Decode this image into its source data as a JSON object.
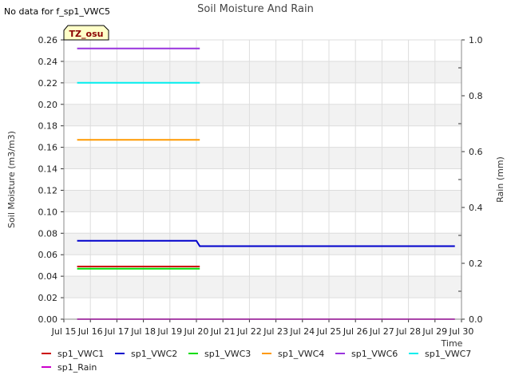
{
  "header": {
    "no_data_note": "No data for f_sp1_VWC5",
    "site_badge": "TZ_osu"
  },
  "colors": {
    "band": "#f2f2f2",
    "grid": "#dddddd",
    "badge_fill": "#ffffc8",
    "badge_text": "#8b0000"
  },
  "chart_data": {
    "type": "line",
    "title": "Soil Moisture And Rain",
    "xlabel": "Time",
    "ylabel": "Soil Moisture (m3/m3)",
    "y2label": "Rain (mm)",
    "x_range": [
      "Jul 15",
      "Jul 30"
    ],
    "x_ticks": [
      "Jul 15",
      "Jul 16",
      "Jul 17",
      "Jul 18",
      "Jul 19",
      "Jul 20",
      "Jul 21",
      "Jul 22",
      "Jul 23",
      "Jul 24",
      "Jul 25",
      "Jul 26",
      "Jul 27",
      "Jul 28",
      "Jul 29",
      "Jul 30"
    ],
    "ylim": [
      0,
      0.26
    ],
    "y_ticks": [
      "0.00",
      "0.02",
      "0.04",
      "0.06",
      "0.08",
      "0.10",
      "0.12",
      "0.14",
      "0.16",
      "0.18",
      "0.20",
      "0.22",
      "0.24",
      "0.26"
    ],
    "y2lim": [
      0,
      1.0
    ],
    "y2_ticks": [
      "0.0",
      "0.2",
      "0.4",
      "0.6",
      "0.8",
      "1.0"
    ],
    "grid": true,
    "legend_position": "bottom",
    "series": [
      {
        "name": "sp1_VWC1",
        "color": "#cc0000",
        "axis": "left",
        "points": [
          [
            "Jul 15 12:00",
            0.049
          ],
          [
            "Jul 20 03:00",
            0.049
          ]
        ]
      },
      {
        "name": "sp1_VWC2",
        "color": "#0000cc",
        "axis": "left",
        "points": [
          [
            "Jul 15 12:00",
            0.073
          ],
          [
            "Jul 20 00:00",
            0.073
          ],
          [
            "Jul 20 03:00",
            0.068
          ],
          [
            "Jul 29 18:00",
            0.068
          ]
        ]
      },
      {
        "name": "sp1_VWC3",
        "color": "#00dd00",
        "axis": "left",
        "points": [
          [
            "Jul 15 12:00",
            0.047
          ],
          [
            "Jul 20 03:00",
            0.047
          ]
        ]
      },
      {
        "name": "sp1_VWC4",
        "color": "#ff9900",
        "axis": "left",
        "points": [
          [
            "Jul 15 12:00",
            0.167
          ],
          [
            "Jul 20 03:00",
            0.167
          ]
        ]
      },
      {
        "name": "sp1_VWC6",
        "color": "#9933dd",
        "axis": "left",
        "points": [
          [
            "Jul 15 12:00",
            0.252
          ],
          [
            "Jul 20 03:00",
            0.252
          ]
        ]
      },
      {
        "name": "sp1_VWC7",
        "color": "#00eeee",
        "axis": "left",
        "points": [
          [
            "Jul 15 12:00",
            0.22
          ],
          [
            "Jul 20 03:00",
            0.22
          ]
        ]
      },
      {
        "name": "sp1_Rain",
        "color": "#cc00cc",
        "axis": "right",
        "points": [
          [
            "Jul 15 12:00",
            0.0
          ],
          [
            "Jul 29 18:00",
            0.0
          ]
        ]
      }
    ]
  }
}
